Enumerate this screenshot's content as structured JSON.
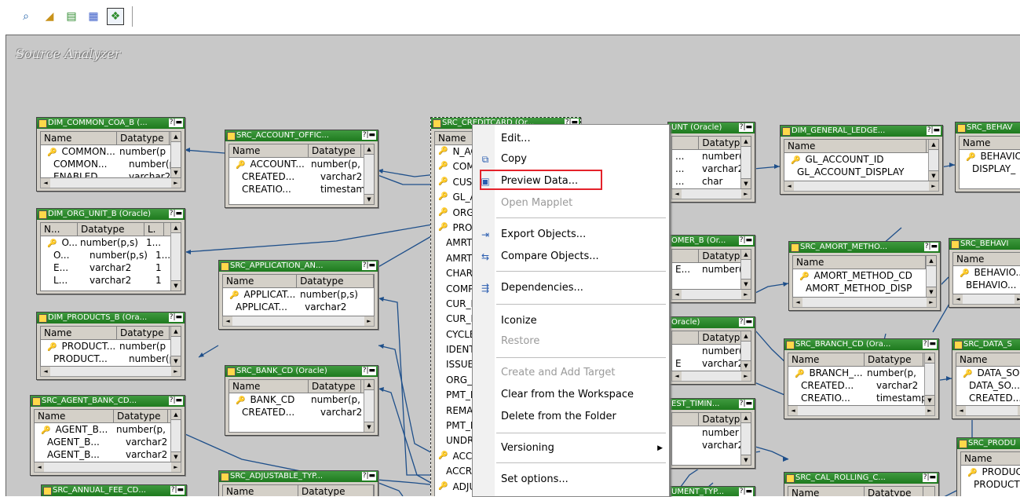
{
  "toolbar": {
    "buttons": [
      {
        "name": "source-analyzer-tool-icon",
        "glyph": "⌕"
      },
      {
        "name": "target-designer-tool-icon",
        "glyph": "◢"
      },
      {
        "name": "transformation-developer-tool-icon",
        "glyph": "▤"
      },
      {
        "name": "mapplet-designer-tool-icon",
        "glyph": "▦"
      },
      {
        "name": "mapping-designer-tool-icon",
        "glyph": "❖"
      }
    ]
  },
  "workspace": {
    "title": "Source Analyzer"
  },
  "tables": {
    "t1": {
      "title": "DIM_COMMON_COA_B (...",
      "h1": "Name",
      "h2": "Datatype",
      "r": [
        [
          "COMMON...",
          "number(p,s"
        ],
        [
          "COMMON...",
          "number(p,s"
        ],
        [
          "ENABLED...",
          "varchar2"
        ]
      ]
    },
    "t2": {
      "title": "DIM_ORG_UNIT_B (Oracle)",
      "h1": "N...",
      "h2": "Datatype",
      "h3": "L.",
      "r": [
        [
          "O...",
          "number(p,s)",
          "1..."
        ],
        [
          "O...",
          "number(p,s)",
          "1..."
        ],
        [
          "E...",
          "varchar2",
          "1"
        ],
        [
          "L...",
          "varchar2",
          "1"
        ]
      ]
    },
    "t3": {
      "title": "DIM_PRODUCTS_B (Ora...",
      "h1": "Name",
      "h2": "Datatype",
      "r": [
        [
          "PRODUCT...",
          "number(p,"
        ],
        [
          "PRODUCT...",
          "number(p,"
        ]
      ]
    },
    "t4": {
      "title": "SRC_AGENT_BANK_CD...",
      "h1": "Name",
      "h2": "Datatype",
      "r": [
        [
          "AGENT_B...",
          "number(p,"
        ],
        [
          "AGENT_B...",
          "varchar2"
        ],
        [
          "AGENT_B...",
          "varchar2"
        ]
      ]
    },
    "t5": {
      "title": "SRC_ANNUAL_FEE_CD..."
    },
    "t6": {
      "title": "SRC_ACCOUNT_OFFIC...",
      "h1": "Name",
      "h2": "Datatype",
      "r": [
        [
          "ACCOUNT...",
          "number(p,"
        ],
        [
          "CREATED...",
          "varchar2"
        ],
        [
          "CREATIO...",
          "timestamp"
        ]
      ]
    },
    "t7": {
      "title": "SRC_APPLICATION_AN...",
      "h1": "Name",
      "h2": "Datatype",
      "r": [
        [
          "APPLICAT...",
          "number(p,s)"
        ],
        [
          "APPLICAT...",
          "varchar2"
        ]
      ]
    },
    "t8": {
      "title": "SRC_BANK_CD (Oracle)",
      "h1": "Name",
      "h2": "Datatype",
      "r": [
        [
          "BANK_CD",
          "number(p,"
        ],
        [
          "CREATED...",
          "varchar2"
        ]
      ]
    },
    "t9": {
      "title": "SRC_ADJUSTABLE_TYP...",
      "h1": "Name",
      "h2": "Datatype"
    },
    "t10": {
      "title": "SRC_CREDITCARD (Or...",
      "h1": "Name",
      "r": [
        "N_ACC",
        "COMM",
        "CUST",
        "GL_AC",
        "ORG_",
        "PROD",
        "AMRT",
        "AMRT",
        "CHAR",
        "COMP",
        "CUR_I",
        "CUR_F",
        "CYCLE",
        "IDENT",
        "ISSUE",
        "ORG_I",
        "PMT_F",
        "REMA",
        "PMT_F",
        "UNDR",
        "ACCOU",
        "ACCRU",
        "ADJUS"
      ]
    },
    "t11": {
      "title": "UNT (Oracle)",
      "h2": "Datatype",
      "r": [
        "number(p,",
        "varchar2",
        "char"
      ]
    },
    "t12": {
      "title": "OMER_B (Or...",
      "h2": "Datatype",
      "r": [
        "number(p,"
      ]
    },
    "t13": {
      "title": "Oracle)",
      "h2": "Datatype",
      "r": [
        "number(p,",
        "varchar2"
      ]
    },
    "t14": {
      "title": "EST_TIMIN...",
      "h2": "Datatype",
      "r": [
        "number",
        "varchar2"
      ]
    },
    "t15": {
      "title": "UMENT_TYP..."
    },
    "t16": {
      "title": "DIM_GENERAL_LEDGE...",
      "h1": "Name",
      "r": [
        "GL_ACCOUNT_ID",
        "GL_ACCOUNT_DISPLAY"
      ]
    },
    "t17": {
      "title": "SRC_AMORT_METHO...",
      "h1": "Name",
      "r": [
        "AMORT_METHOD_CD",
        "AMORT_METHOD_DISP"
      ]
    },
    "t18": {
      "title": "SRC_BRANCH_CD (Ora...",
      "h1": "Name",
      "h2": "Datatype",
      "r": [
        [
          "BRANCH_...",
          "number(p,"
        ],
        [
          "CREATED...",
          "varchar2"
        ],
        [
          "CREATIO...",
          "timestamp"
        ]
      ]
    },
    "t19": {
      "title": "SRC_CAL_ROLLING_C...",
      "h1": "Name",
      "h2": "Datatype"
    },
    "t20": {
      "title": "SRC_BEHAV",
      "h1": "Name",
      "r": [
        "BEHAVIO...",
        "DISPLAY_"
      ]
    },
    "t21": {
      "title": "SRC_BEHAVI",
      "h1": "Name",
      "r": [
        "BEHAVIO...",
        "BEHAVIO..."
      ]
    },
    "t22": {
      "title": "SRC_DATA_S",
      "h1": "Name",
      "r": [
        "DATA_SO...",
        "DATA_SO...",
        "CREATED..."
      ]
    },
    "t23": {
      "title": "SRC_PRODU",
      "h1": "Name",
      "r": [
        "PRODUCT",
        "PRODUCT"
      ]
    }
  },
  "context_menu": {
    "edit": "Edit...",
    "copy": "Copy",
    "preview": "Preview Data...",
    "open_mapplet": "Open Mapplet",
    "export": "Export Objects...",
    "compare": "Compare Objects...",
    "dependencies": "Dependencies...",
    "iconize": "Iconize",
    "restore": "Restore",
    "create_target": "Create and Add Target",
    "clear": "Clear from the Workspace",
    "delete": "Delete from the Folder",
    "versioning": "Versioning",
    "set_options": "Set options..."
  }
}
